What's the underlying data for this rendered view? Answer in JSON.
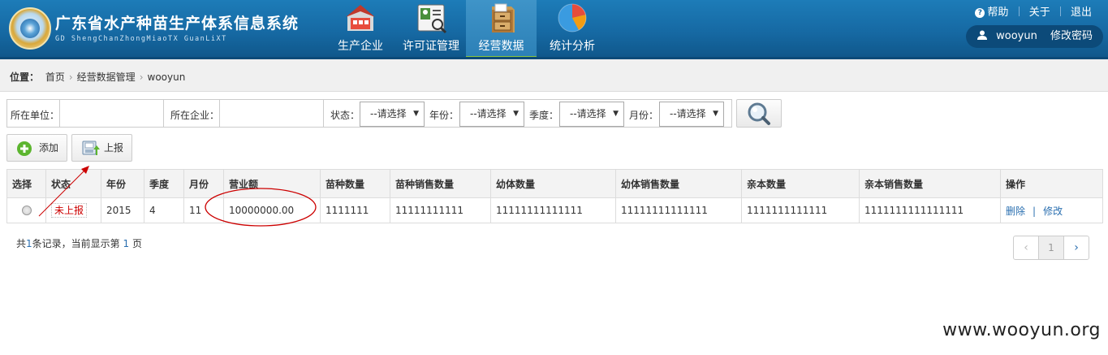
{
  "header": {
    "title": "广东省水产种苗生产体系信息系统",
    "subtitle": "GD ShengChanZhongMiaoTX GuanLiXT",
    "nav": [
      {
        "label": "生产企业",
        "icon": "factory-icon"
      },
      {
        "label": "许可证管理",
        "icon": "license-icon"
      },
      {
        "label": "经营数据",
        "icon": "cabinet-icon",
        "active": true
      },
      {
        "label": "统计分析",
        "icon": "pie-chart-icon"
      }
    ],
    "help": "帮助",
    "about": "关于",
    "logout": "退出",
    "username": "wooyun",
    "change_password": "修改密码"
  },
  "breadcrumb": {
    "prefix": "位置：",
    "items": [
      "首页",
      "经营数据管理",
      "wooyun"
    ]
  },
  "filters": {
    "unit_label": "所在单位：",
    "unit_value": "",
    "company_label": "所在企业：",
    "company_value": "",
    "status_label": "状态：",
    "status_value": "--请选择",
    "year_label": "年份：",
    "year_value": "--请选择",
    "quarter_label": "季度：",
    "quarter_value": "--请选择",
    "month_label": "月份：",
    "month_value": "--请选择"
  },
  "actions": {
    "add_label": "添加",
    "report_label": "上报"
  },
  "table": {
    "headers": [
      "选择",
      "状态",
      "年份",
      "季度",
      "月份",
      "营业额",
      "苗种数量",
      "苗种销售数量",
      "幼体数量",
      "幼体销售数量",
      "亲本数量",
      "亲本销售数量",
      "操作"
    ],
    "rows": [
      {
        "status": "未上报",
        "year": "2015",
        "quarter": "4",
        "month": "11",
        "revenue": "10000000.00",
        "seed_qty": "1111111",
        "seed_sales": "11111111111",
        "larva_qty": "11111111111111",
        "larva_sales": "11111111111111",
        "parent_qty": "1111111111111",
        "parent_sales": "1111111111111111",
        "delete": "删除",
        "edit": "修改",
        "op_sep": "|"
      }
    ]
  },
  "footer": {
    "record_prefix": "共",
    "record_count": "1",
    "record_mid": "条记录，当前显示第",
    "current_page": "1",
    "record_suffix": "页",
    "pager_prev": "‹",
    "pager_page": "1",
    "pager_next": "›"
  },
  "watermark": "www.wooyun.org",
  "colors": {
    "header_blue": "#1669a3",
    "active_tab_underline": "#8bc53f",
    "status_red": "#cc0000",
    "link_blue": "#2a6fb0",
    "annotation_red": "#cc0000"
  }
}
